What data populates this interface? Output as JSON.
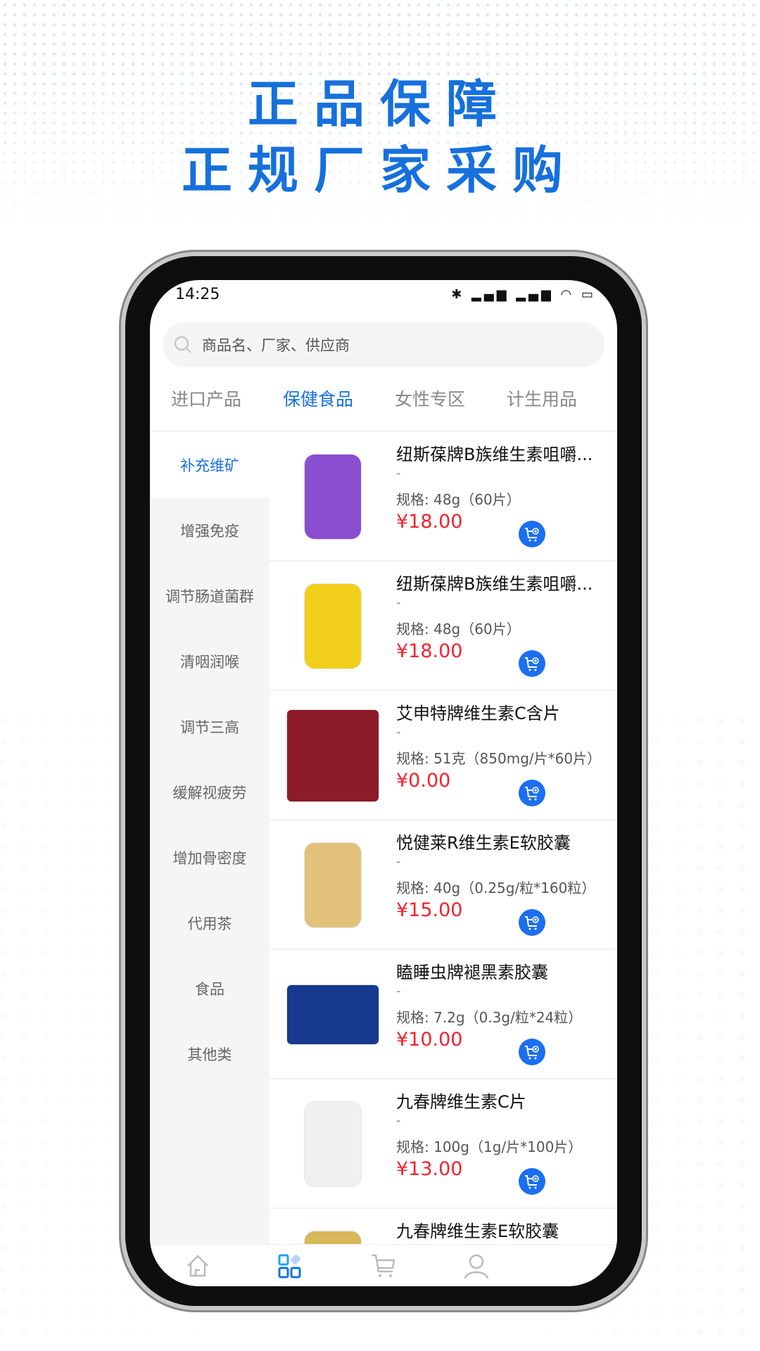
{
  "headline": {
    "line1": "正品保障",
    "line2": "正规厂家采购",
    "color": "#1670dc"
  },
  "status_bar": {
    "time": "14:25"
  },
  "search": {
    "placeholder": "商品名、厂家、供应商"
  },
  "tabs": [
    {
      "label": "进口产品"
    },
    {
      "label": "保健食品",
      "active": true
    },
    {
      "label": "女性专区"
    },
    {
      "label": "计生用品"
    }
  ],
  "sidebar": {
    "items": [
      {
        "label": "补充维矿",
        "active": true
      },
      {
        "label": "增强免疫"
      },
      {
        "label": "调节肠道菌群"
      },
      {
        "label": "清咽润喉"
      },
      {
        "label": "调节三高"
      },
      {
        "label": "缓解视疲劳"
      },
      {
        "label": "增加骨密度"
      },
      {
        "label": "代用茶"
      },
      {
        "label": "食品"
      },
      {
        "label": "其他类"
      }
    ]
  },
  "products": [
    {
      "title": "纽斯葆牌B族维生素咀嚼...",
      "sub": "-",
      "spec": "规格: 48g（60片）",
      "price": "¥18.00",
      "thumb_color": "#8a4fd0"
    },
    {
      "title": "纽斯葆牌B族维生素咀嚼...",
      "sub": "-",
      "spec": "规格: 48g（60片）",
      "price": "¥18.00",
      "thumb_color": "#f2cf1a"
    },
    {
      "title": "艾申特牌维生素C含片",
      "sub": "-",
      "spec": "规格: 51克（850mg/片*60片）",
      "price": "¥0.00",
      "thumb_color": "#8c1b2a"
    },
    {
      "title": "悦健莱R维生素E软胶囊",
      "sub": "-",
      "spec": "规格: 40g（0.25g/粒*160粒）",
      "price": "¥15.00",
      "thumb_color": "#e2c27a"
    },
    {
      "title": "瞌睡虫牌褪黑素胶囊",
      "sub": "-",
      "spec": "规格: 7.2g（0.3g/粒*24粒）",
      "price": "¥10.00",
      "thumb_color": "#173a8f"
    },
    {
      "title": "九春牌维生素C片",
      "sub": "-",
      "spec": "规格: 100g（1g/片*100片）",
      "price": "¥13.00",
      "thumb_color": "#f0f0f0"
    },
    {
      "title": "九春牌维生素E软胶囊",
      "sub": "",
      "spec": "",
      "price": "",
      "thumb_color": "#d8b85a"
    }
  ],
  "bottom_nav": [
    {
      "icon": "home-icon"
    },
    {
      "icon": "category-icon",
      "active": true
    },
    {
      "icon": "cart-icon"
    },
    {
      "icon": "user-icon"
    }
  ],
  "colors": {
    "accent": "#1670dc",
    "price": "#f5222d",
    "cart_button": "#1b6ff0"
  }
}
